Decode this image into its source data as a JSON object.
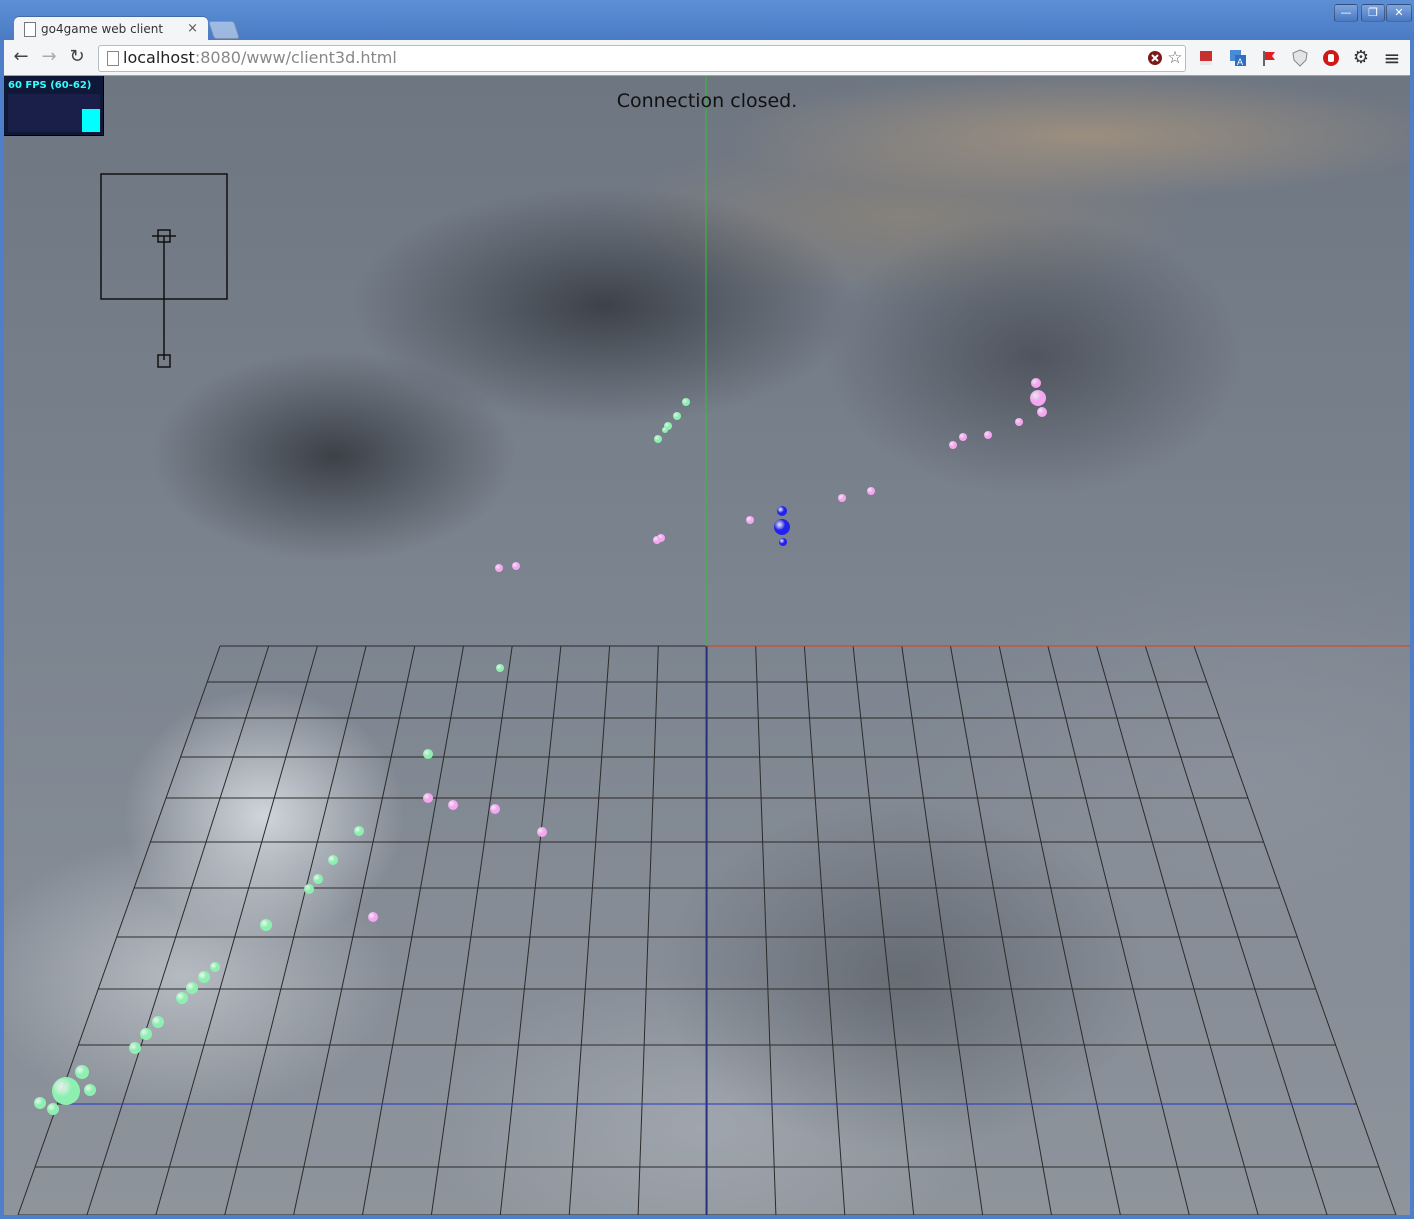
{
  "browser": {
    "tab_title": "go4game web client",
    "tab_close": "×",
    "url_host": "localhost",
    "url_path": ":8080/www/client3d.html",
    "window_buttons": {
      "minimize": "—",
      "maximize": "❐",
      "close": "✕"
    }
  },
  "toolbar": {
    "back": "←",
    "forward": "→",
    "reload": "↻",
    "bookmark_star": "☆",
    "menu": "≡"
  },
  "hud": {
    "fps_label": "60 FPS (60-62)",
    "status_message": "Connection closed."
  },
  "colors": {
    "player_team": "#8ef0b0",
    "enemy_team": "#f4a6f0",
    "self": "#2222ee",
    "axis_x": "#e0401c",
    "axis_y": "#30c030",
    "axis_z": "#2233cc",
    "grid": "#2b2b2b"
  },
  "icons": {
    "page": "page-icon",
    "stop": "stop-icon",
    "star": "star-icon",
    "extensions": [
      "bookmark-ext-icon",
      "translate-ext-icon",
      "flag-ext-icon",
      "shield-ext-icon",
      "adblock-ext-icon",
      "gear-icon",
      "menu-icon"
    ]
  }
}
